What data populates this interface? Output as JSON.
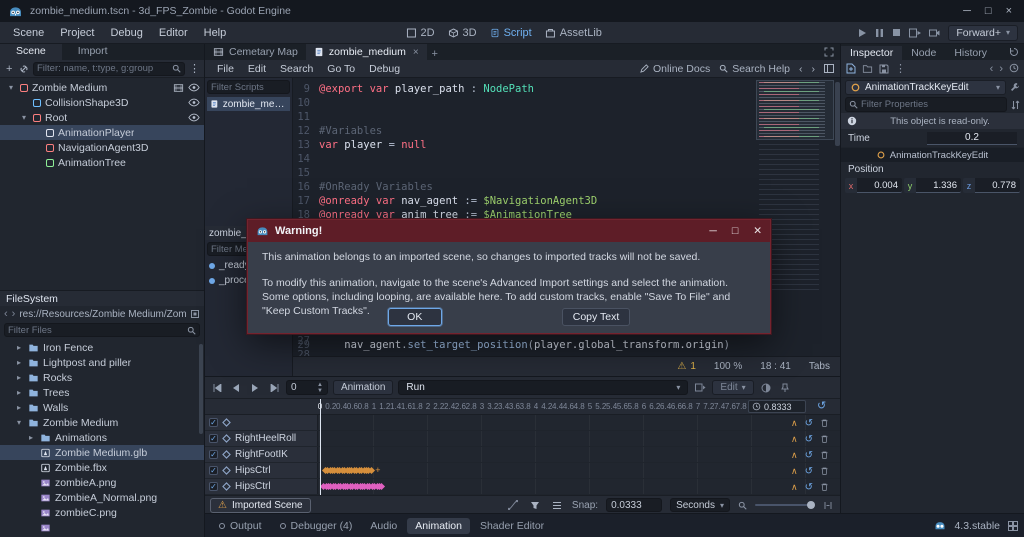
{
  "titlebar": {
    "title": "zombie_medium.tscn - 3d_FPS_Zombie - Godot Engine"
  },
  "menubar": {
    "menus": [
      "Scene",
      "Project",
      "Debug",
      "Editor",
      "Help"
    ],
    "workspaces": [
      {
        "label": "2D",
        "active": false
      },
      {
        "label": "3D",
        "active": false
      },
      {
        "label": "Script",
        "active": true
      },
      {
        "label": "AssetLib",
        "active": false
      }
    ],
    "renderer": "Forward+"
  },
  "left_dock": {
    "tabs": [
      {
        "label": "Scene",
        "active": true
      },
      {
        "label": "Import",
        "active": false
      }
    ],
    "scene_filter_placeholder": "Filter: name, t:type, g:group",
    "scene_tree": [
      {
        "label": "Zombie Medium",
        "depth": 0,
        "color": "#fc7f7f",
        "arrow": true,
        "eye": true,
        "extra": true
      },
      {
        "label": "CollisionShape3D",
        "depth": 1,
        "color": "#6fbfff",
        "arrow": false,
        "eye": true,
        "extra": false
      },
      {
        "label": "Root",
        "depth": 1,
        "color": "#fc7f7f",
        "arrow": true,
        "eye": true,
        "extra": false
      },
      {
        "label": "AnimationPlayer",
        "depth": 2,
        "color": "#e0e4ef",
        "arrow": false,
        "eye": false,
        "extra": false,
        "selected": true
      },
      {
        "label": "NavigationAgent3D",
        "depth": 2,
        "color": "#fc7f7f",
        "arrow": false,
        "eye": false,
        "extra": false
      },
      {
        "label": "AnimationTree",
        "depth": 2,
        "color": "#8eef97",
        "arrow": false,
        "eye": false,
        "extra": false
      }
    ],
    "filesystem_title": "FileSystem",
    "filesystem_path": "res://Resources/Zombie Medium/Zombie M",
    "files_filter_placeholder": "Filter Files",
    "file_tree": [
      {
        "label": "Iron Fence",
        "depth": 1,
        "kind": "folder",
        "expanded": false
      },
      {
        "label": "Lightpost and piller",
        "depth": 1,
        "kind": "folder",
        "expanded": false
      },
      {
        "label": "Rocks",
        "depth": 1,
        "kind": "folder",
        "expanded": false
      },
      {
        "label": "Trees",
        "depth": 1,
        "kind": "folder",
        "expanded": false
      },
      {
        "label": "Walls",
        "depth": 1,
        "kind": "folder",
        "expanded": false
      },
      {
        "label": "Zombie Medium",
        "depth": 1,
        "kind": "folder",
        "expanded": true
      },
      {
        "label": "Animations",
        "depth": 2,
        "kind": "folder",
        "expanded": false
      },
      {
        "label": "Zombie Medium.glb",
        "depth": 2,
        "kind": "scene",
        "selected": true
      },
      {
        "label": "Zombie.fbx",
        "depth": 2,
        "kind": "scene"
      },
      {
        "label": "zombieA.png",
        "depth": 2,
        "kind": "image"
      },
      {
        "label": "ZombieA_Normal.png",
        "depth": 2,
        "kind": "image"
      },
      {
        "label": "zombieC.png",
        "depth": 2,
        "kind": "image"
      },
      {
        "label": "",
        "depth": 2,
        "kind": "image"
      }
    ]
  },
  "script_editor": {
    "tabs": [
      {
        "label": "Cemetary Map",
        "active": false
      },
      {
        "label": "zombie_medium",
        "active": true
      }
    ],
    "menus": [
      "File",
      "Edit",
      "Search",
      "Go To",
      "Debug"
    ],
    "online_docs": "Online Docs",
    "search_help": "Search Help",
    "scripts_filter_placeholder": "Filter Scripts",
    "script_item": "zombie_medium",
    "members_tab": "zombie_medium",
    "members_filter_placeholder": "Filter Methods",
    "members": [
      "_ready",
      "_process"
    ],
    "status": {
      "warnings": "1",
      "zoom": "100 %",
      "caret": "18 : 41",
      "indent": "Tabs"
    }
  },
  "code": {
    "lines": [
      {
        "n": "9",
        "seg": [
          [
            "@export ",
            "kw"
          ],
          [
            "var ",
            "kw"
          ],
          [
            "player_path ",
            "id"
          ],
          [
            ": ",
            "op"
          ],
          [
            "NodePath",
            "type"
          ]
        ]
      },
      {
        "n": "10",
        "seg": []
      },
      {
        "n": "11",
        "seg": []
      },
      {
        "n": "12",
        "seg": [
          [
            "#Variables",
            "com"
          ]
        ]
      },
      {
        "n": "13",
        "seg": [
          [
            "var ",
            "kw"
          ],
          [
            "player ",
            "id"
          ],
          [
            "= ",
            "op"
          ],
          [
            "null",
            "kw"
          ]
        ]
      },
      {
        "n": "14",
        "seg": []
      },
      {
        "n": "15",
        "seg": []
      },
      {
        "n": "16",
        "seg": [
          [
            "#OnReady Variables",
            "com"
          ]
        ]
      },
      {
        "n": "17",
        "seg": [
          [
            "@onready ",
            "kw"
          ],
          [
            "var ",
            "kw"
          ],
          [
            "nav_agent ",
            "id"
          ],
          [
            ":= ",
            "op"
          ],
          [
            "$NavigationAgent3D",
            "node"
          ]
        ]
      },
      {
        "n": "18",
        "seg": [
          [
            "@onready ",
            "kw"
          ],
          [
            "var ",
            "kw"
          ],
          [
            "anim_tree ",
            "id"
          ],
          [
            ":= ",
            "op"
          ],
          [
            "$AnimationTree",
            "node"
          ]
        ]
      },
      {
        "n": "19",
        "seg": []
      }
    ],
    "far_line": {
      "n": "29",
      "seg": [
        [
          "    ",
          "id"
        ],
        [
          "nav_agent",
          "id"
        ],
        [
          ".",
          "op"
        ],
        [
          "set_target_position",
          "fn"
        ],
        [
          "(",
          "op"
        ],
        [
          "player.global_transform.origin",
          "id"
        ],
        [
          ")",
          "op"
        ]
      ]
    }
  },
  "dialog": {
    "title": "Warning!",
    "line1": "This animation belongs to an imported scene, so changes to imported tracks will not be saved.",
    "line2": "To modify this animation, navigate to the scene's Advanced Import settings and select the animation.",
    "line3": "Some options, including looping, are available here. To add custom tracks, enable \"Save To File\" and",
    "line4": "\"Keep Custom Tracks\".",
    "ok": "OK",
    "copy": "Copy Text"
  },
  "inspector": {
    "tabs": [
      {
        "label": "Inspector",
        "active": true
      },
      {
        "label": "Node",
        "active": false
      },
      {
        "label": "History",
        "active": false
      }
    ],
    "object_dropdown": "AnimationTrackKeyEdit",
    "filter_placeholder": "Filter Properties",
    "readonly_notice": "This object is read-only.",
    "time_label": "Time",
    "time_value": "0.2",
    "section": "AnimationTrackKeyEdit",
    "subsection": "Position",
    "vector": [
      {
        "axis": "x",
        "value": "0.004",
        "color": "#e06a6a"
      },
      {
        "axis": "y",
        "value": "1.336",
        "color": "#8fd16a"
      },
      {
        "axis": "z",
        "value": "0.778",
        "color": "#6a9ae0"
      }
    ]
  },
  "animation": {
    "time_value": "0",
    "menu_label": "Animation",
    "selected_animation": "Run",
    "edit_label": "Edit",
    "ruler": {
      "start": 0,
      "step": 0.2,
      "end": 7.8
    },
    "current_time": "0.8333",
    "tracks": [
      {
        "label": "",
        "keys": null
      },
      {
        "label": "RightHeelRoll",
        "keys": null
      },
      {
        "label": "RightFootIK",
        "keys": null
      },
      {
        "label": "HipsCtrl",
        "keys": {
          "color": "#d68f3c",
          "start": 0.05,
          "step": 0.045,
          "count": 20,
          "plus": true
        }
      },
      {
        "label": "HipsCtrl",
        "keys": {
          "color": "#e060c0",
          "start": 0.02,
          "step": 0.045,
          "count": 25,
          "plus": false
        }
      }
    ],
    "imported_scene": "Imported Scene",
    "snap_label": "Snap:",
    "snap_value": "0.0333",
    "snap_unit": "Seconds"
  },
  "bottom_bar": {
    "items": [
      {
        "label": "Output",
        "dot": true,
        "active": false
      },
      {
        "label": "Debugger (4)",
        "dot": true,
        "active": false
      },
      {
        "label": "Audio",
        "dot": false,
        "active": false
      },
      {
        "label": "Animation",
        "dot": false,
        "active": true
      },
      {
        "label": "Shader Editor",
        "dot": false,
        "active": false
      }
    ],
    "version": "4.3.stable"
  }
}
